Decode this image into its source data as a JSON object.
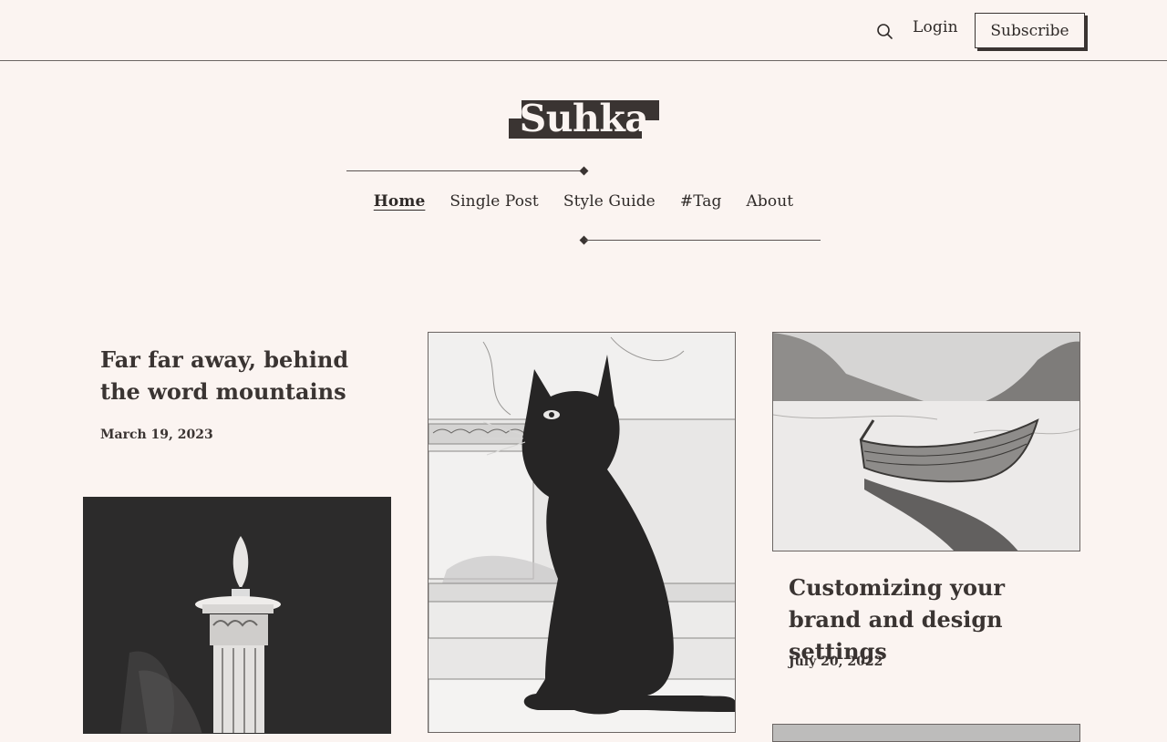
{
  "header": {
    "login_label": "Login",
    "subscribe_label": "Subscribe",
    "search_icon": "search-icon"
  },
  "brand": {
    "name": "Suhka"
  },
  "nav": {
    "items": [
      {
        "label": "Home",
        "active": true
      },
      {
        "label": "Single Post",
        "active": false
      },
      {
        "label": "Style Guide",
        "active": false
      },
      {
        "label": "#Tag",
        "active": false
      },
      {
        "label": "About",
        "active": false
      }
    ]
  },
  "posts": [
    {
      "title": "Far far away, behind the word mountains",
      "date": "March 19, 2023"
    },
    {
      "title": "Customizing your brand and design settings",
      "date": "July 20, 2022"
    }
  ],
  "images": {
    "candle": "candle-pillar-illustration",
    "cat": "black-cat-illustration",
    "boat": "rowboat-lake-illustration"
  },
  "colors": {
    "background": "#fbf4f1",
    "ink": "#2f2a28",
    "dark_panel": "#2c2b2b"
  }
}
